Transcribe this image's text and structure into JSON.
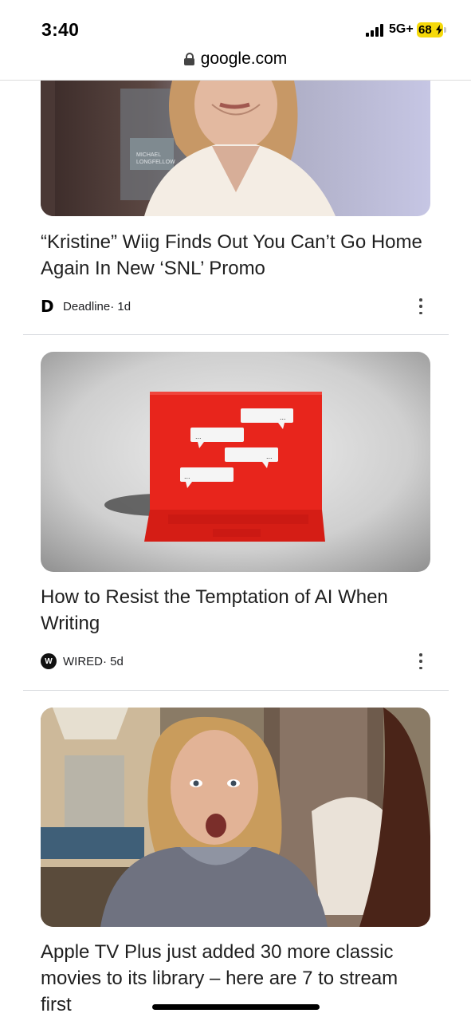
{
  "status_bar": {
    "time": "3:40",
    "network": "5G+",
    "battery": "68",
    "battery_color": "#f5d90a",
    "signal_icon": "signal-bars-icon",
    "charging_icon": "bolt-icon"
  },
  "browser": {
    "url": "google.com",
    "lock_icon": "lock-icon"
  },
  "articles": [
    {
      "headline": "“Kristine” Wiig Finds Out You Can’t Go Home Again In New ‘SNL’ Promo",
      "source": "Deadline",
      "age": " · 1d",
      "source_logo_letter": "D",
      "image_text": [
        "MICHAEL",
        "LONGFELLOW"
      ]
    },
    {
      "headline": "How to Resist the Temptation of AI When Writing",
      "source": "WIRED",
      "age": " · 5d",
      "source_logo_letter": "W",
      "bubbles": [
        "...",
        "...",
        "...",
        "..."
      ],
      "accent": "#e8251c"
    },
    {
      "headline": "Apple TV Plus just added 30 more classic movies to its library – here are 7 to stream first"
    }
  ],
  "menu_icon": "more-vert-icon"
}
